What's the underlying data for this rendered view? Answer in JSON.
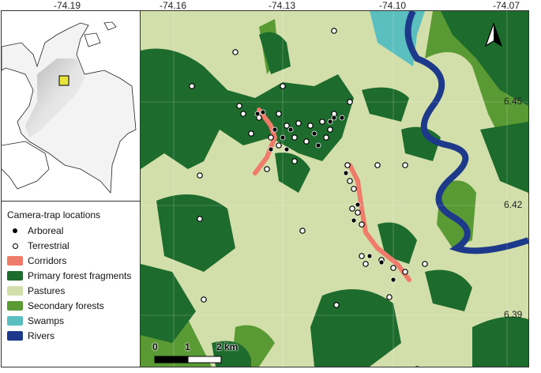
{
  "axes": {
    "longitude_ticks": [
      "-74.19",
      "-74.16",
      "-74.13",
      "-74.10",
      "-74.07"
    ],
    "latitude_ticks": [
      "6.45",
      "6.42",
      "6.39"
    ]
  },
  "legend": {
    "title": "Camera-trap locations",
    "items": [
      {
        "label": "Arboreal",
        "kind": "point-filled"
      },
      {
        "label": "Terrestrial",
        "kind": "point-open"
      },
      {
        "label": "Corridors",
        "color": "#ef7b6a"
      },
      {
        "label": "Primary forest fragments",
        "color": "#1e6b2e"
      },
      {
        "label": "Pastures",
        "color": "#d3dfaa"
      },
      {
        "label": "Secondary forests",
        "color": "#5a9a34"
      },
      {
        "label": "Swamps",
        "color": "#5bbfbf"
      },
      {
        "label": "Rivers",
        "color": "#1d3a8a"
      }
    ]
  },
  "scale_bar": {
    "labels": [
      "0",
      "1",
      "2 km"
    ]
  },
  "inset": {
    "highlight_color": "#e8e43a"
  },
  "north_arrow": "north-arrow-icon"
}
